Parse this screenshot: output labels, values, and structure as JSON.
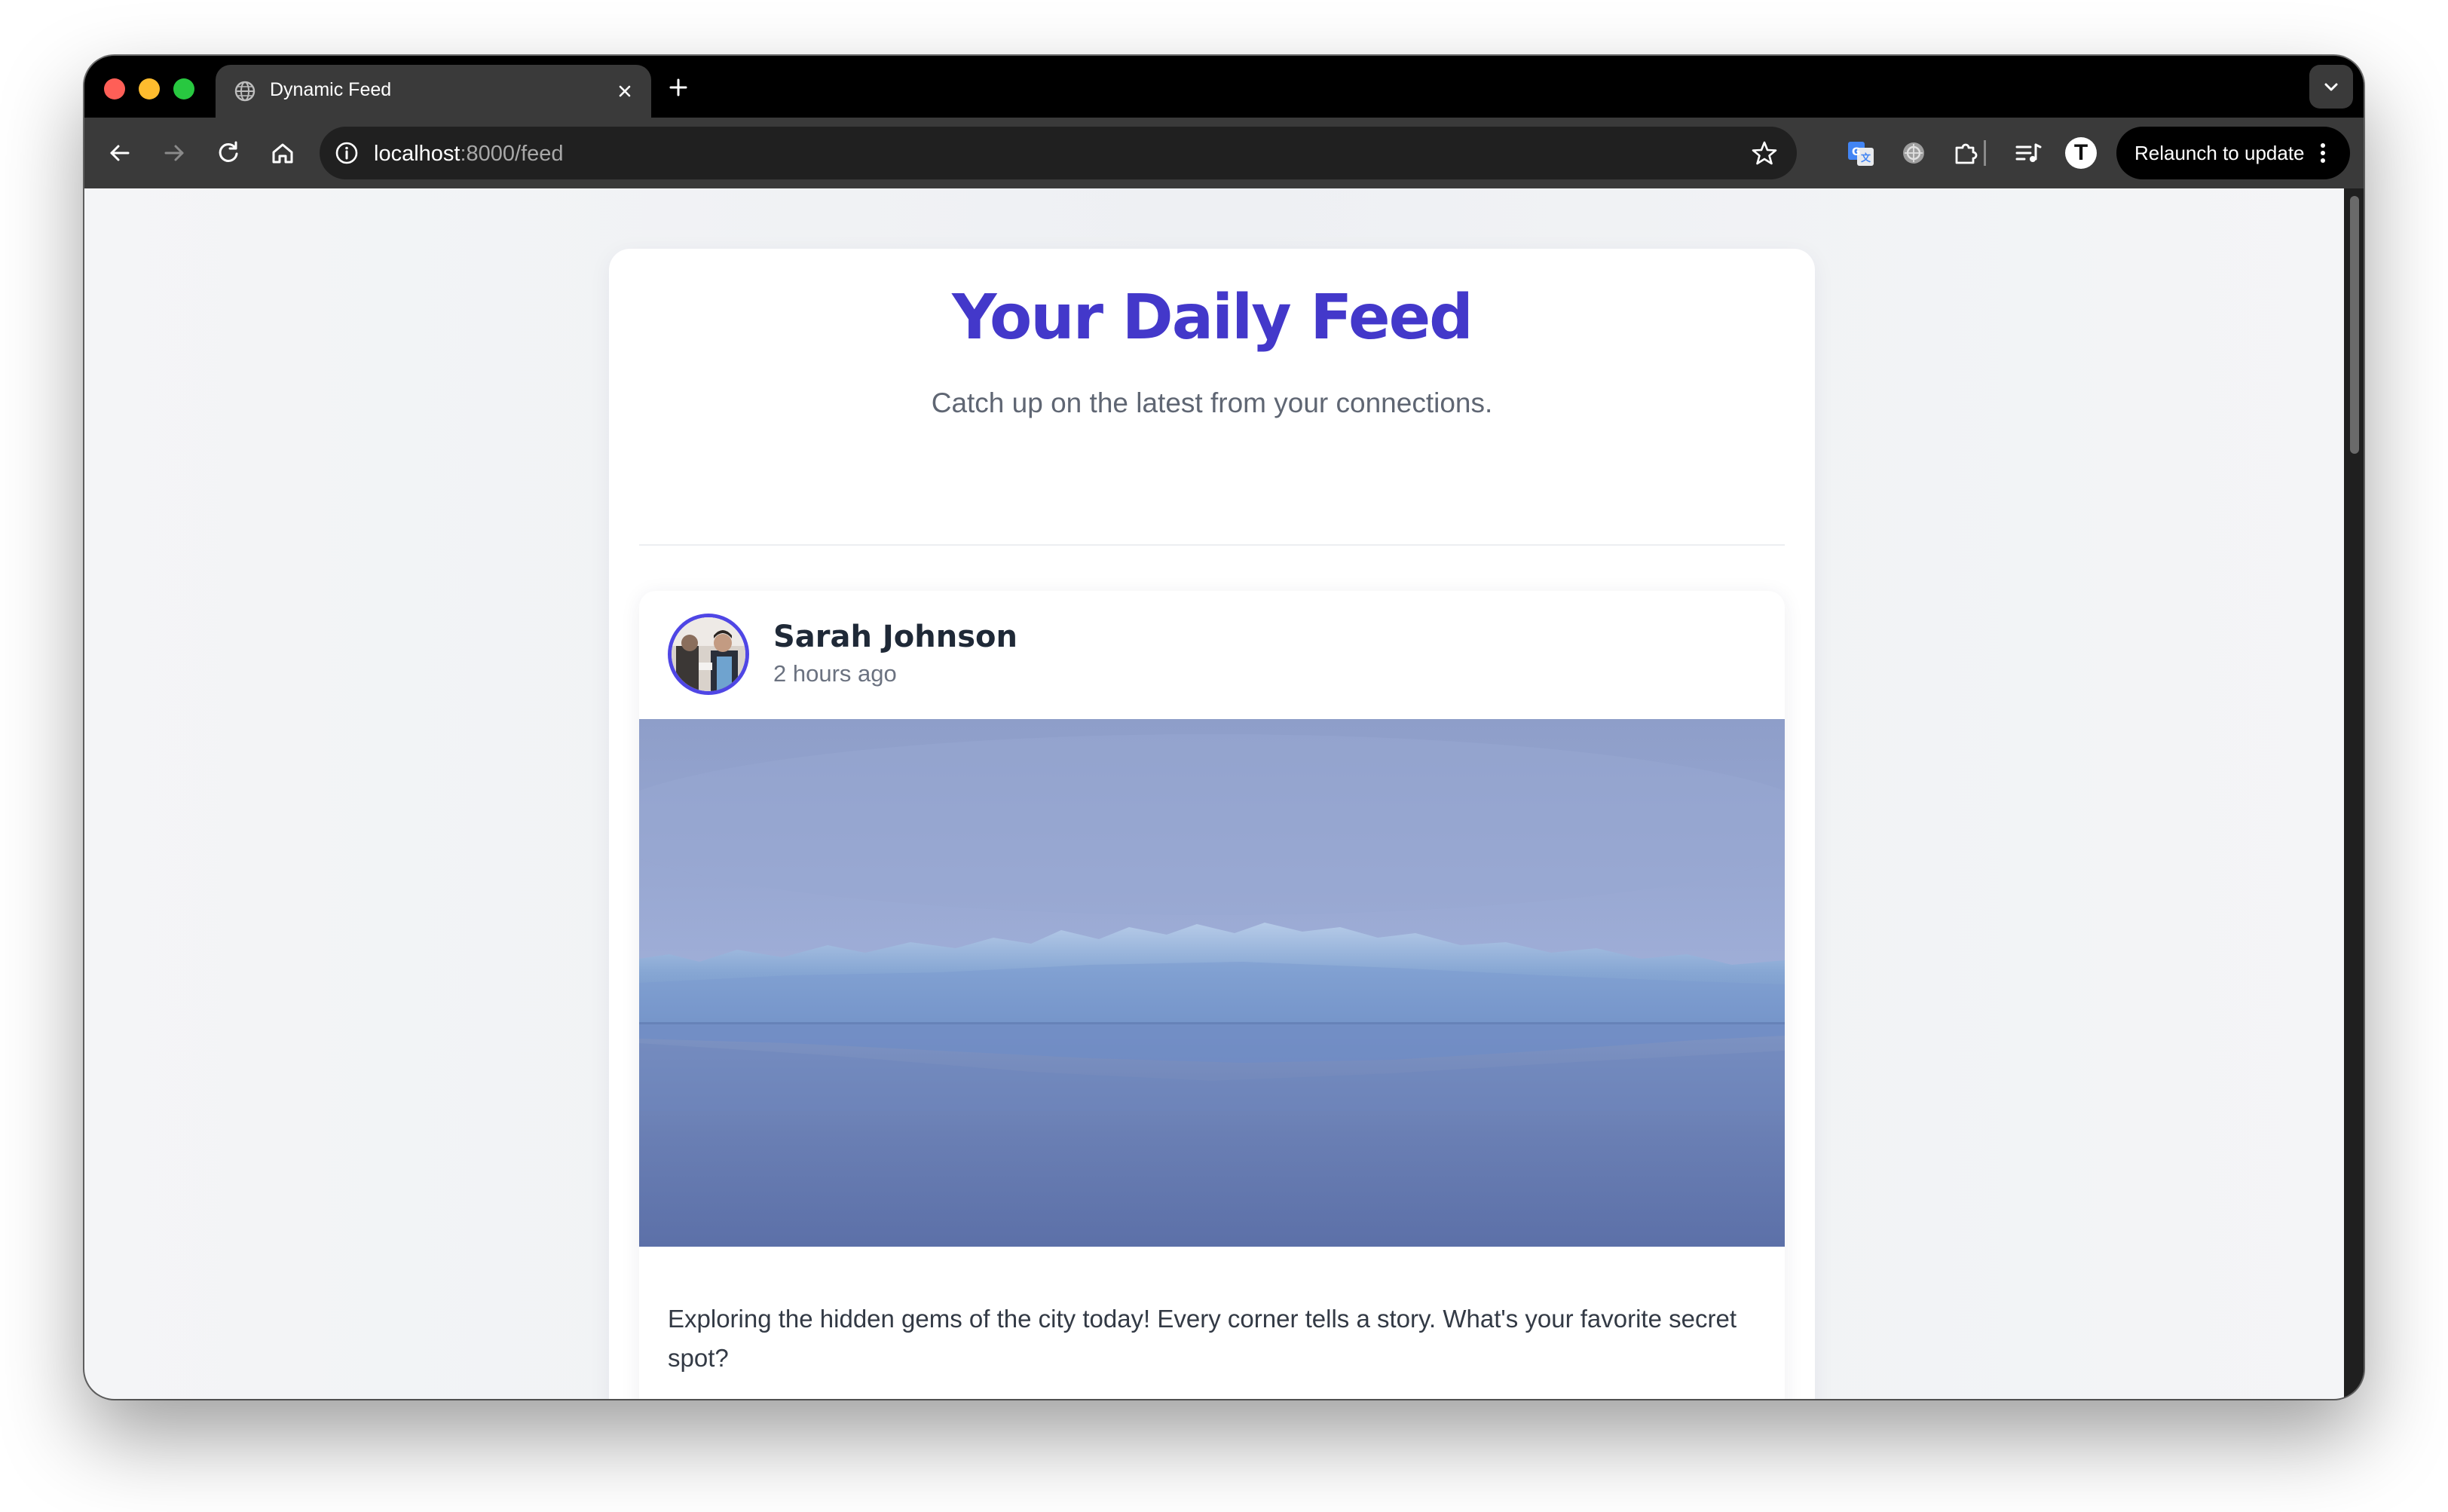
{
  "browser": {
    "tab": {
      "title": "Dynamic Feed",
      "favicon": "globe-icon"
    },
    "url": {
      "host": "localhost",
      "rest": ":8000/feed"
    },
    "profile_initial": "T",
    "relaunch_label": "Relaunch to update",
    "icons": [
      "back-icon",
      "forward-icon",
      "reload-icon",
      "home-icon",
      "site-info-icon",
      "bookmark-star-icon",
      "google-translate-icon",
      "extension-icon",
      "puzzle-icon",
      "media-control-icon",
      "more-vert-icon",
      "tab-search-icon"
    ]
  },
  "feed": {
    "title": "Your Daily Feed",
    "subtitle": "Catch up on the latest from your connections."
  },
  "posts": [
    {
      "author": "Sarah Johnson",
      "time": "2 hours ago",
      "text": "Exploring the hidden gems of the city today! Every corner tells a story. What's your favorite secret spot?",
      "image": "glacier-lake-photo"
    }
  ],
  "colors": {
    "accent": "#4338ca",
    "avatar_ring": "#4f46e5",
    "text_primary": "#1f2937",
    "text_secondary": "#6b7280"
  }
}
